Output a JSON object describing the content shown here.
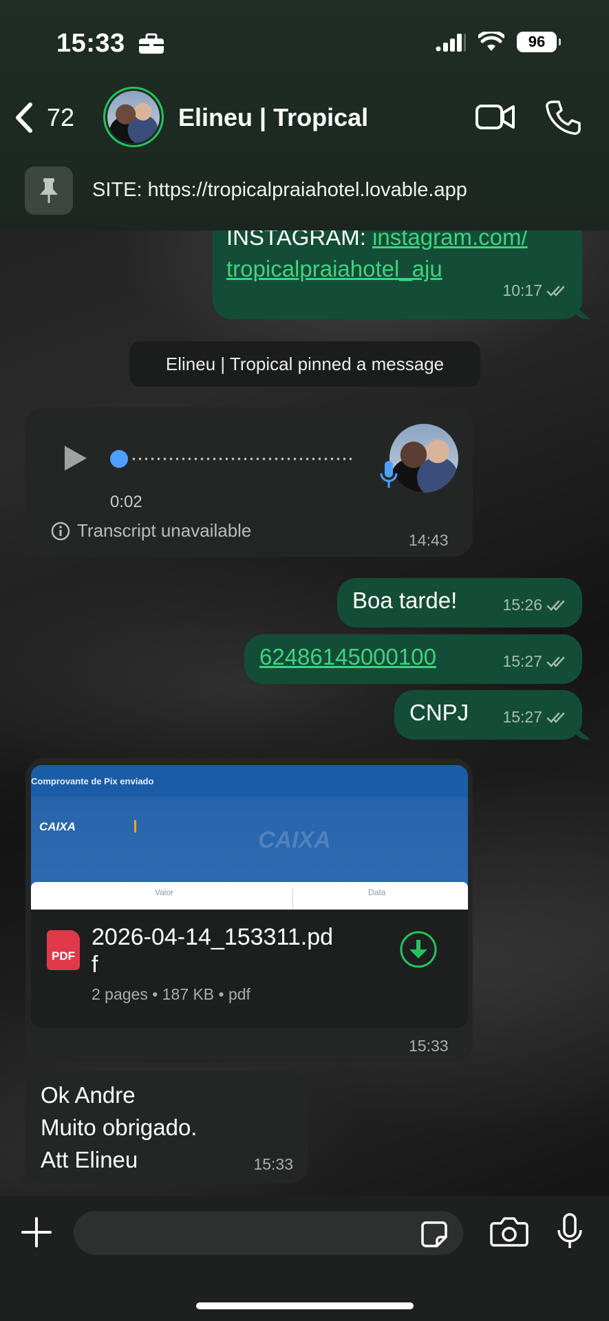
{
  "status_bar": {
    "time": "15:33",
    "battery": "96"
  },
  "header": {
    "back_count": "72",
    "contact_name": "Elineu | Tropical",
    "pinned_text": "SITE: https://tropicalpraiahotel.lovable.app"
  },
  "messages": {
    "m1": {
      "prefix": "INSTAGRAM: ",
      "link_line1": "instagram.com/",
      "link_line2": "tropicalpraiahotel_aju",
      "time": "10:17"
    },
    "system": "Elineu | Tropical pinned a message",
    "voice": {
      "duration": "0:02",
      "transcript": "Transcript unavailable",
      "time": "14:43",
      "progress": 0
    },
    "m2": {
      "text": "Boa tarde!",
      "time": "15:26"
    },
    "m3": {
      "text": "62486145000100",
      "time": "15:27"
    },
    "m4": {
      "text": "CNPJ",
      "time": "15:27"
    },
    "doc": {
      "preview_title": "Comprovante de Pix enviado",
      "preview_brand": "CAIXA",
      "preview_col1": "Valor",
      "preview_col2": "Data",
      "badge": "PDF",
      "filename_line1": "2026-04-14_153311.pd",
      "filename_line2": "f",
      "details": "2 pages • 187 KB • pdf",
      "time": "15:33"
    },
    "m5": {
      "line1": "Ok Andre",
      "line2": "Muito obrigado.",
      "line3": "Att Elineu",
      "time": "15:33"
    }
  },
  "colors": {
    "outgoing_bubble": "#144d37",
    "incoming_bubble": "#242626",
    "accent_green": "#23c45e",
    "link_green": "#3fd37e",
    "voice_dot": "#4da0ff"
  }
}
